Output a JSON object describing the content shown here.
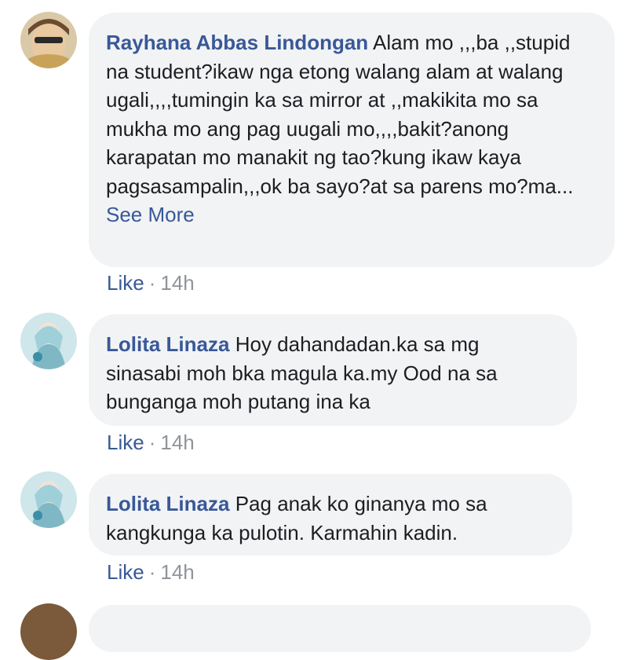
{
  "comments": [
    {
      "author": "Rayhana Abbas Lindongan",
      "text": "Alam mo ,,,ba ,,stupid na student?ikaw nga etong walang alam at walang ugali,,,,tumingin ka sa mirror at ,,makikita mo sa mukha mo ang pag uugali mo,,,,bakit?anong karapatan mo manakit ng tao?kung ikaw kaya pagsasampalin,,,ok ba sayo?at sa parens mo?ma...",
      "see_more": "See More",
      "like": "Like",
      "separator": "·",
      "time": "14h"
    },
    {
      "author": "Lolita Linaza",
      "text": "Hoy dahandadan.ka sa mg sinasabi moh bka magula ka.my Ood na sa bunganga moh putang ina ka",
      "like": "Like",
      "separator": "·",
      "time": "14h"
    },
    {
      "author": "Lolita Linaza",
      "text": "Pag anak ko ginanya mo sa kangkunga ka pulotin. Karmahin kadin.",
      "like": "Like",
      "separator": "·",
      "time": "14h"
    }
  ],
  "colors": {
    "name": "#385898",
    "bubble": "#f2f3f5",
    "meta": "#90949c"
  }
}
